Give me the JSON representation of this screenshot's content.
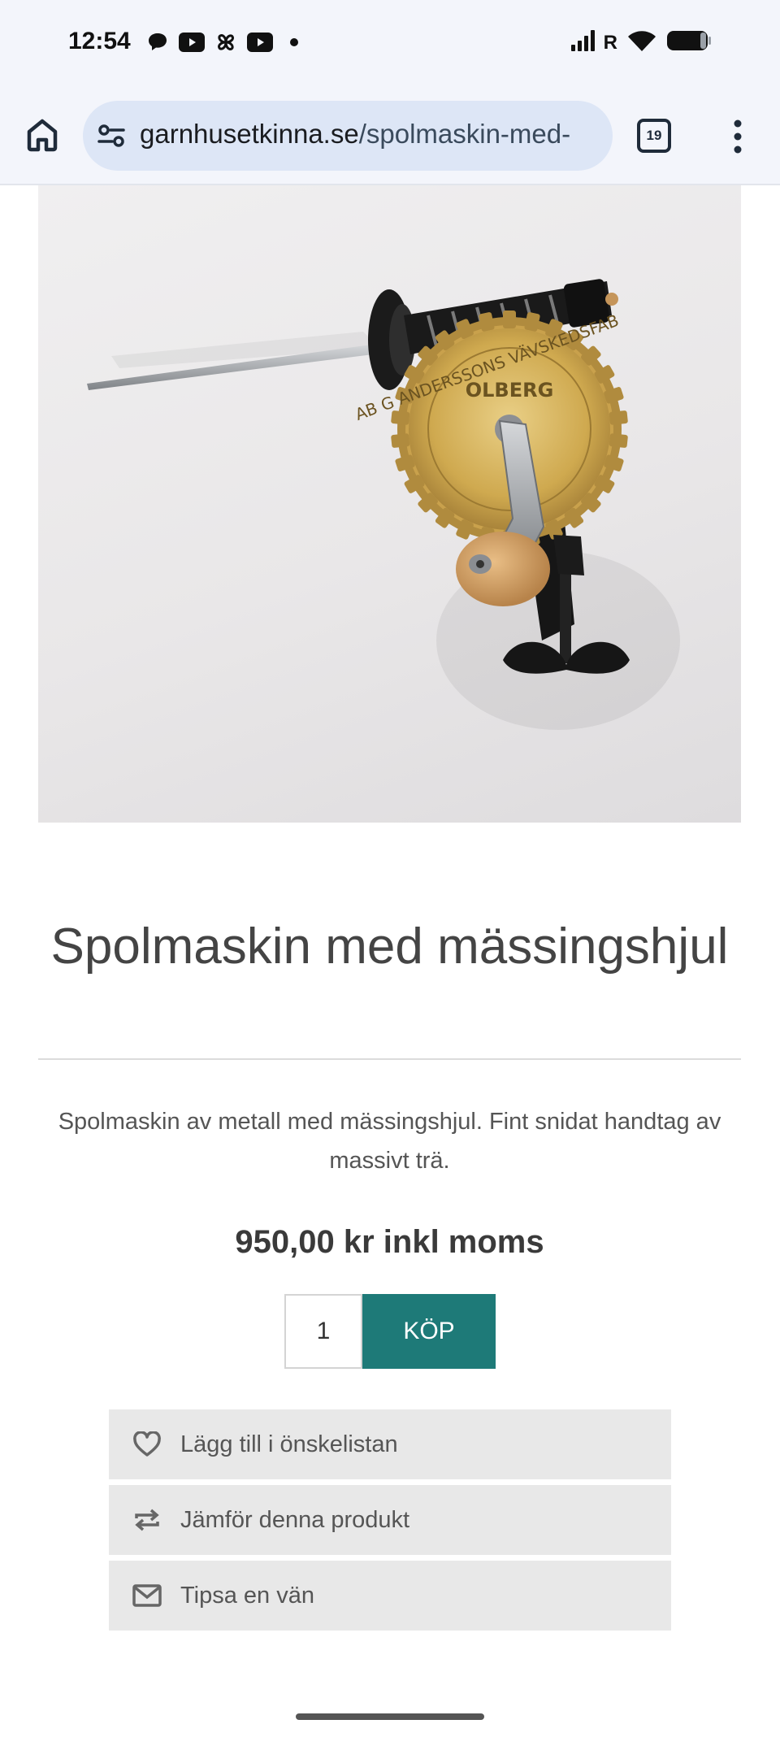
{
  "status_bar": {
    "time": "12:54",
    "notification_icons": [
      "chat-bubble-icon",
      "youtube-icon",
      "pinwheel-icon",
      "youtube-icon",
      "dot-icon"
    ],
    "right_icons": [
      "signal-icon",
      "roaming-indicator",
      "wifi-icon",
      "battery-icon"
    ],
    "roaming": "R"
  },
  "browser": {
    "url_domain": "garnhusetkinna.se",
    "url_path": "/spolmaskin-med-",
    "tab_count": "19"
  },
  "product": {
    "image_alt": "Spolmaskin med mässingshjul",
    "wheel_text": "AB G ANDERSSONS VÄVSKEDSFAB",
    "wheel_brand": "OLBERG",
    "title": "Spolmaskin med mässingshjul",
    "description": "Spolmaskin av metall med mässingshjul. Fint snidat handtag av massivt trä.",
    "price": "950,00 kr inkl moms",
    "quantity": "1",
    "buy_label": "KÖP"
  },
  "actions": [
    {
      "label": "Lägg till i önskelistan",
      "icon": "heart-icon"
    },
    {
      "label": "Jämför denna produkt",
      "icon": "compare-icon"
    },
    {
      "label": "Tipsa en vän",
      "icon": "mail-icon"
    }
  ],
  "colors": {
    "accent": "#1e7a78",
    "status_bg": "#f3f5fb",
    "url_pill": "#dde6f6"
  }
}
